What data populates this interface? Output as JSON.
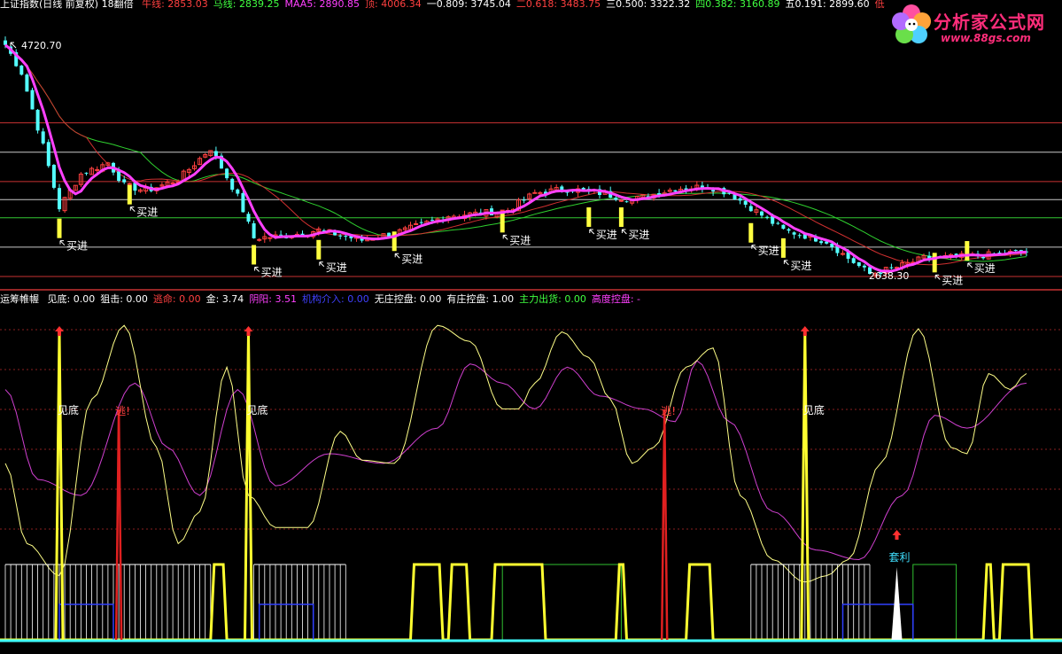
{
  "header": {
    "title": "上证指数(日线 前复权) 18翻倍",
    "items": [
      {
        "label": "牛线: 2853.03",
        "color": "#ff4040"
      },
      {
        "label": "马线: 2839.25",
        "color": "#40ff40"
      },
      {
        "label": "MAA5: 2890.85",
        "color": "#ff40ff"
      },
      {
        "label": "顶: 4006.34",
        "color": "#ff4040"
      },
      {
        "label": "一0.809: 3745.04",
        "color": "#ffffff"
      },
      {
        "label": "二0.618: 3483.75",
        "color": "#ff4040"
      },
      {
        "label": "三0.500: 3322.32",
        "color": "#ffffff"
      },
      {
        "label": "四0.382: 3160.89",
        "color": "#40ff40"
      },
      {
        "label": "五0.191: 2899.60",
        "color": "#ffffff"
      },
      {
        "label": "低",
        "color": "#ff4040"
      }
    ]
  },
  "logo": {
    "name": "分析家公式网",
    "url": "www.88gs.com"
  },
  "price_chart": {
    "high_label": "4720.70",
    "low_label": "2638.30",
    "buy_label": "买进",
    "buy_signals": [
      {
        "idx": 10,
        "price": 2980
      },
      {
        "idx": 23,
        "price": 3280
      },
      {
        "idx": 46,
        "price": 2745
      },
      {
        "idx": 58,
        "price": 2790
      },
      {
        "idx": 72,
        "price": 2865
      },
      {
        "idx": 92,
        "price": 3030
      },
      {
        "idx": 108,
        "price": 3080
      },
      {
        "idx": 114,
        "price": 3080
      },
      {
        "idx": 138,
        "price": 2940
      },
      {
        "idx": 144,
        "price": 2805
      },
      {
        "idx": 172,
        "price": 2675
      },
      {
        "idx": 178,
        "price": 2780
      }
    ],
    "levels": [
      {
        "name": "顶",
        "value": 4006.34,
        "color": "#c83232"
      },
      {
        "name": "一",
        "value": 3745.04,
        "color": "#c8c8c8"
      },
      {
        "name": "二",
        "value": 3483.75,
        "color": "#c83232"
      },
      {
        "name": "三",
        "value": 3322.32,
        "color": "#c8c8c8"
      },
      {
        "name": "四",
        "value": 3160.89,
        "color": "#32c832"
      },
      {
        "name": "五",
        "value": 2899.6,
        "color": "#c8c8c8"
      },
      {
        "name": "低",
        "value": 2638.3,
        "color": "#c83232"
      }
    ]
  },
  "indicator": {
    "title": "运筹帷幄",
    "items": [
      {
        "label": "见底: 0.00",
        "color": "#ffffff"
      },
      {
        "label": "狙击: 0.00",
        "color": "#ffffff"
      },
      {
        "label": "逃命: 0.00",
        "color": "#ff4040"
      },
      {
        "label": "金: 3.74",
        "color": "#ffffff"
      },
      {
        "label": "阴阳: 3.51",
        "color": "#ff40ff"
      },
      {
        "label": "机构介入: 0.00",
        "color": "#4040ff"
      },
      {
        "label": "无庄控盘: 0.00",
        "color": "#ffffff"
      },
      {
        "label": "有庄控盘: 1.00",
        "color": "#ffffff"
      },
      {
        "label": "主力出货: 0.00",
        "color": "#40ff40"
      },
      {
        "label": "高度控盘: -",
        "color": "#ff40ff"
      }
    ],
    "bottom_label": "见底",
    "escape_label": "逃!",
    "profit_label": "套利",
    "bottom_signals": [
      10,
      45,
      148
    ],
    "escape_signals": [
      21,
      122
    ],
    "profit_signals": [
      165
    ]
  }
}
